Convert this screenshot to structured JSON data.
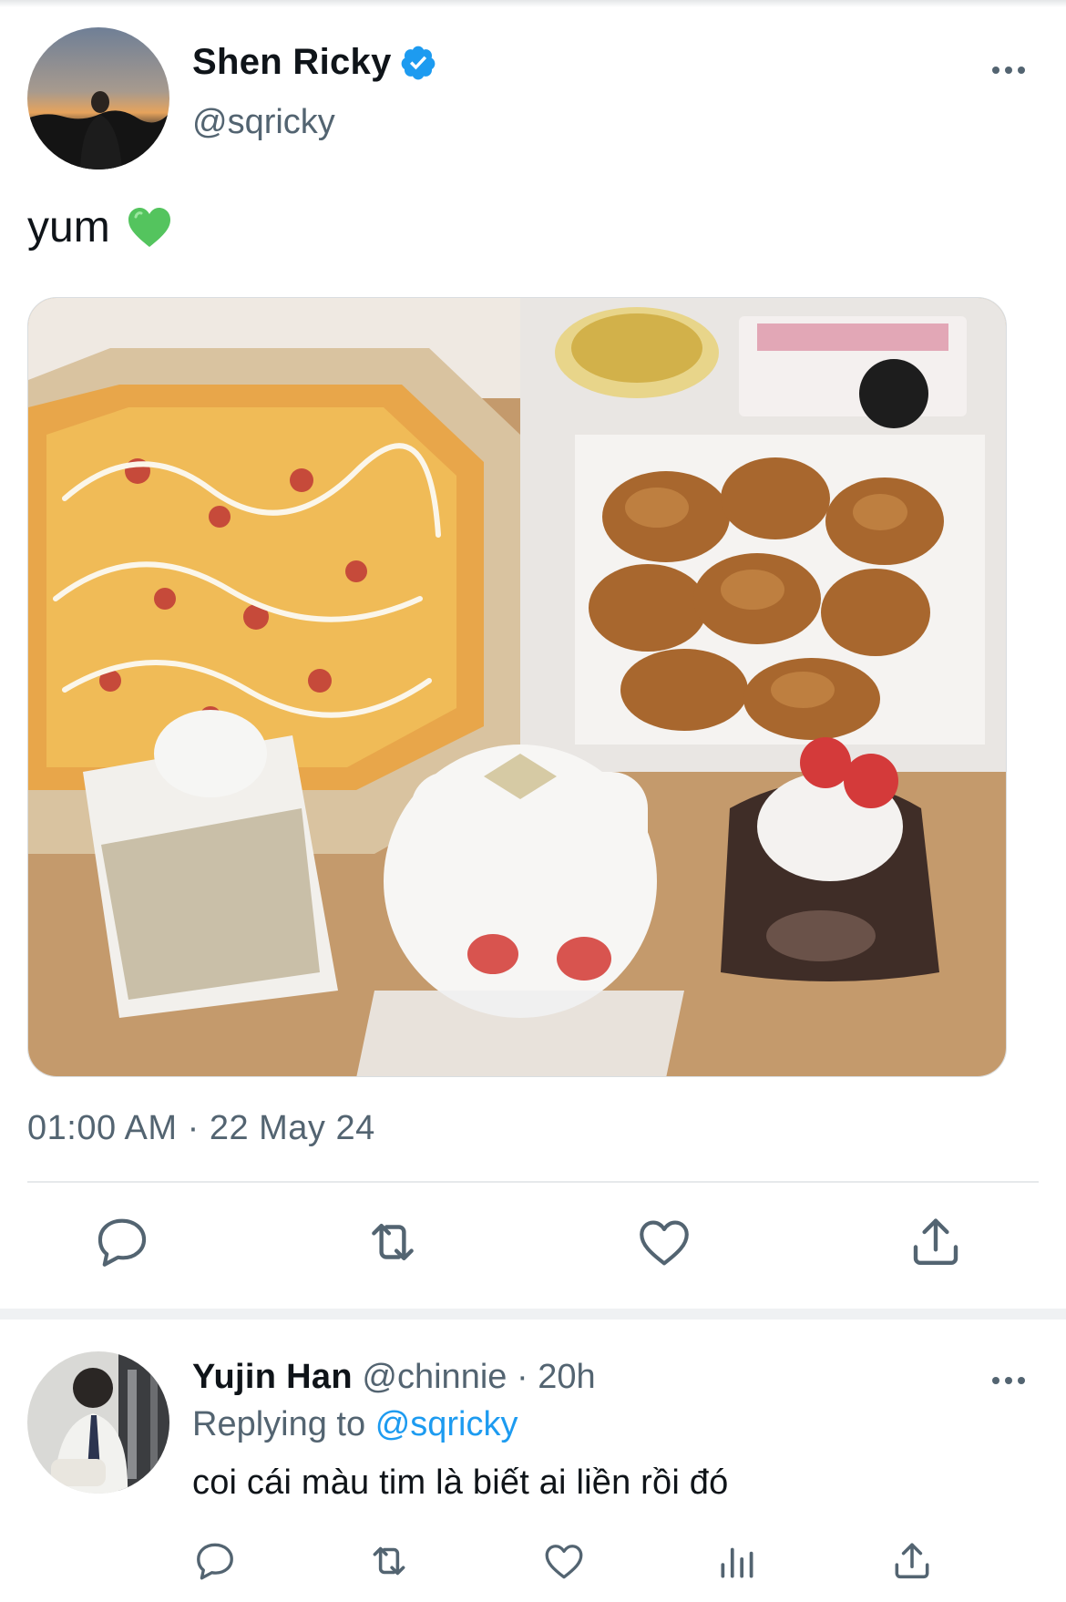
{
  "tweet": {
    "author_name": "Shen Ricky",
    "handle": "@sqricky",
    "verified_icon": "verified-badge-icon",
    "text": "yum",
    "emoji": "green-heart-emoji",
    "media_alt": "photo",
    "timestamp": "01:00 AM · 22 May 24",
    "actions": [
      "reply-icon",
      "retweet-icon",
      "like-icon",
      "share-icon"
    ]
  },
  "reply": {
    "author_name": "Yujin Han",
    "handle": "@chinnie",
    "separator": "·",
    "time": "20h",
    "replying_prefix": "Replying to",
    "replying_to": "@sqricky",
    "text": "coi cái màu tim là biết ai liền rồi đó",
    "actions": [
      "reply-icon",
      "retweet-icon",
      "like-icon",
      "analytics-icon",
      "share-icon"
    ]
  },
  "colors": {
    "text_primary": "#0f1419",
    "text_secondary": "#536471",
    "accent": "#1d9bf0",
    "heart_emoji": "#54c45e"
  }
}
